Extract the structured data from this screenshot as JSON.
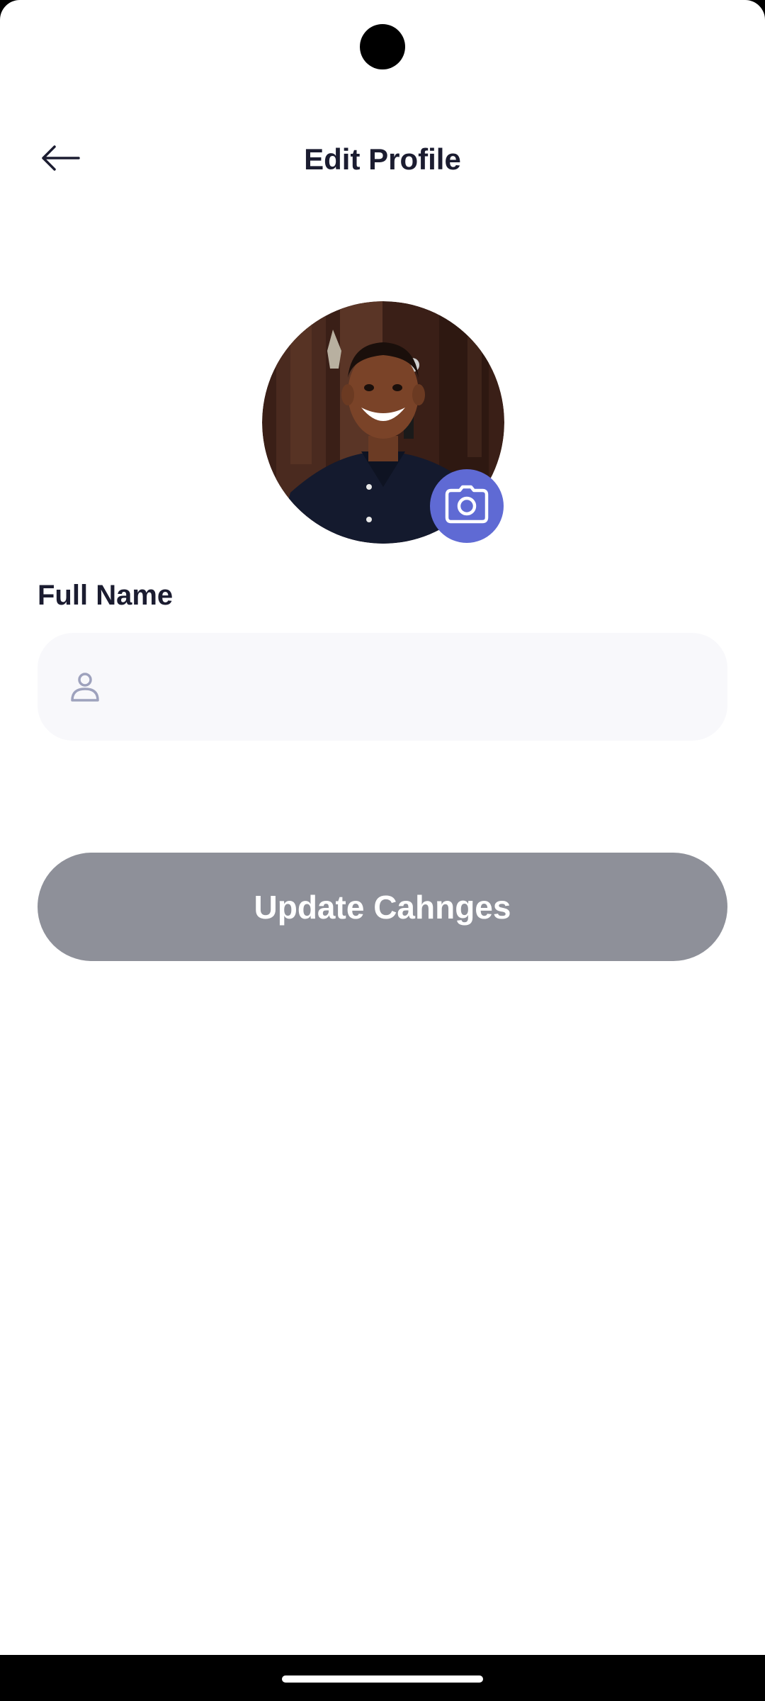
{
  "header": {
    "title": "Edit Profile",
    "back_icon": "arrow-left-icon"
  },
  "profile": {
    "avatar_icon": "profile-photo",
    "camera_icon": "camera-icon",
    "camera_color": "#5f6ad4"
  },
  "form": {
    "full_name_label": "Full Name",
    "full_name_value": "",
    "full_name_placeholder": "",
    "full_name_icon": "user-icon"
  },
  "actions": {
    "update_label": "Update Cahnges",
    "update_color": "#8e9099",
    "update_enabled": false
  },
  "colors": {
    "text_primary": "#1b1c30",
    "input_bg": "#f8f8fb",
    "icon_muted": "#9ea2bd",
    "accent": "#5f6ad4",
    "button_disabled": "#8e9099"
  }
}
